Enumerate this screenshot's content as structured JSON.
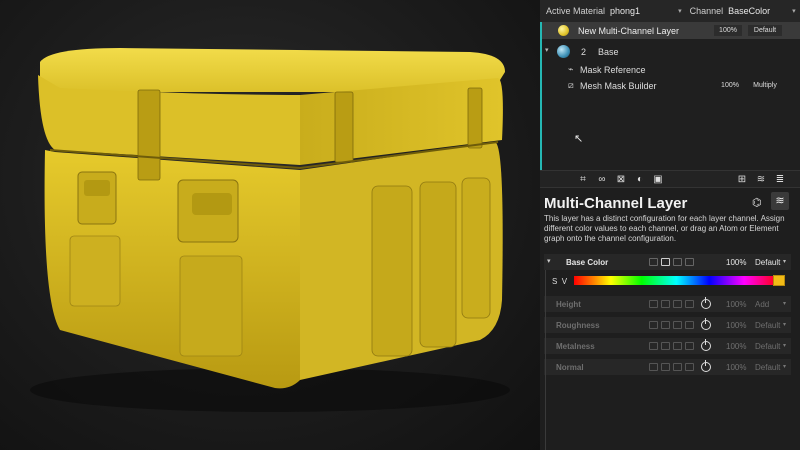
{
  "topbar": {
    "active_material_label": "Active Material",
    "active_material_value": "phong1",
    "channel_label": "Channel",
    "channel_value": "BaseColor"
  },
  "layers": [
    {
      "name": "New Multi-Channel Layer",
      "opacity": "100%",
      "blend": "Default",
      "selected": true
    },
    {
      "name": "Base",
      "index": "2",
      "expanded": true
    },
    {
      "name": "Mask Reference"
    },
    {
      "name": "Mesh Mask Builder",
      "opacity": "100%",
      "blend": "Multiply"
    }
  ],
  "properties": {
    "title": "Multi-Channel Layer",
    "description": "This layer has a distinct configuration for each layer channel. Assign different color values to each channel, or drag an Atom or Element graph onto the channel configuration."
  },
  "channels": [
    {
      "name": "Base Color",
      "opacity": "100%",
      "blend": "Default",
      "active": true
    },
    {
      "name": "Height",
      "opacity": "100%",
      "blend": "Add",
      "active": false
    },
    {
      "name": "Roughness",
      "opacity": "100%",
      "blend": "Default",
      "active": false
    },
    {
      "name": "Metalness",
      "opacity": "100%",
      "blend": "Default",
      "active": false
    },
    {
      "name": "Normal",
      "opacity": "100%",
      "blend": "Default",
      "active": false
    }
  ],
  "color_picker": {
    "s_label": "S",
    "v_label": "V",
    "swatch_color": "#f2bb16"
  },
  "colors": {
    "accent": "#25b8b4",
    "case_yellow": "#e3c52a"
  }
}
